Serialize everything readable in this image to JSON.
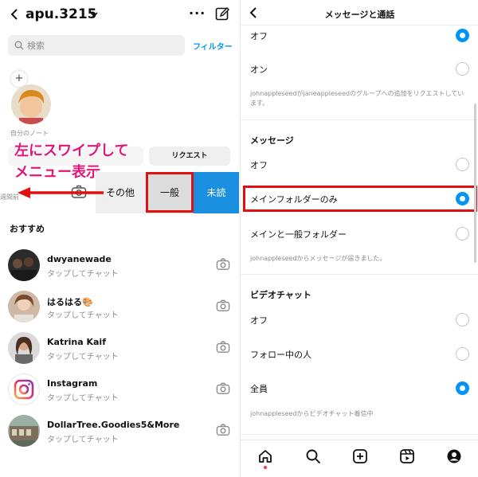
{
  "left": {
    "username": "apu.3215",
    "search_placeholder": "検索",
    "filter_label": "フィルター",
    "note_add": "+",
    "note_label": "自分のノート",
    "tab_requests": "リクエスト",
    "swipe_annotation": "左にスワイプして\nメニュー表示",
    "week_label": "週間前",
    "swipe_actions": {
      "other": "その他",
      "general": "一般",
      "unread": "未読"
    },
    "suggested_heading": "おすすめ",
    "contacts": [
      {
        "name": "dwyanewade",
        "sub": "タップしてチャット"
      },
      {
        "name": "はるはる🎨",
        "sub": "タップしてチャット"
      },
      {
        "name": "Katrina Kaif",
        "sub": "タップしてチャット"
      },
      {
        "name": "Instagram",
        "sub": "タップしてチャット"
      },
      {
        "name": "DollarTree.Goodies5&More",
        "sub": "タップしてチャット"
      }
    ]
  },
  "right": {
    "title": "メッセージと通話",
    "top_options": [
      {
        "label": "オフ",
        "selected": true
      },
      {
        "label": "オン",
        "selected": false
      }
    ],
    "group_desc": "johnappleseedがjaneappleseedのグループへの追加をリクエストしています。",
    "messages": {
      "heading": "メッセージ",
      "options": [
        {
          "label": "オフ",
          "selected": false
        },
        {
          "label": "メインフォルダーのみ",
          "selected": true
        },
        {
          "label": "メインと一般フォルダー",
          "selected": false
        }
      ],
      "desc": "johnappleseedからメッセージが届きました。"
    },
    "video": {
      "heading": "ビデオチャット",
      "options": [
        {
          "label": "オフ",
          "selected": false
        },
        {
          "label": "フォロー中の人",
          "selected": false
        },
        {
          "label": "全員",
          "selected": true
        }
      ],
      "desc": "johnappleseedからビデオチャット着信中"
    }
  },
  "colors": {
    "accent": "#0095f6",
    "annotation": "#e0177a",
    "highlight": "#e01010",
    "unread_bg": "#1a8fe0"
  }
}
